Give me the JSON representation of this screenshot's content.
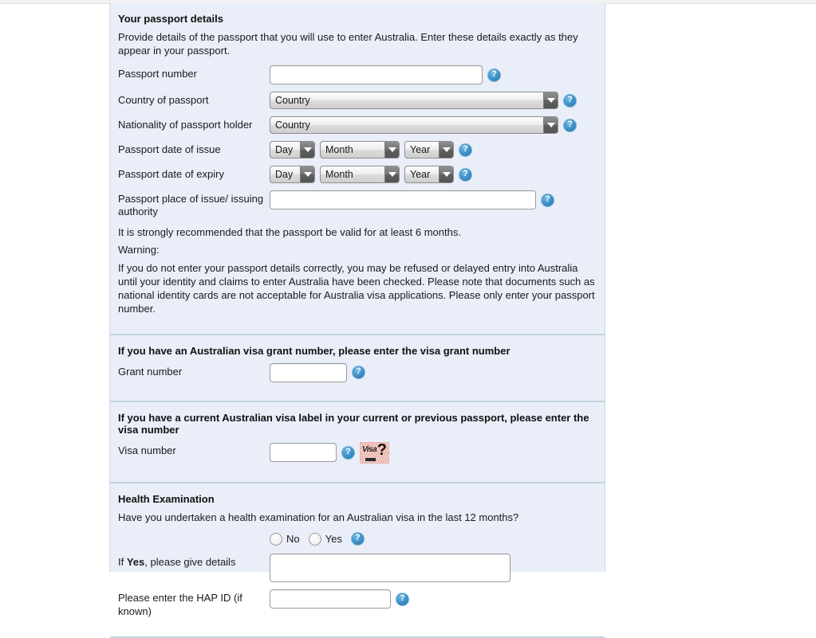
{
  "passport_section": {
    "title": "Your passport details",
    "description": "Provide details of the passport that you will use to enter Australia. Enter these details exactly as they appear in your passport.",
    "fields": {
      "passport_number_label": "Passport number",
      "passport_number_value": "",
      "country_of_passport_label": "Country of passport",
      "country_of_passport_value": "Country",
      "nationality_label": "Nationality of passport holder",
      "nationality_value": "Country",
      "date_of_issue_label": "Passport date of issue",
      "date_of_expiry_label": "Passport date of expiry",
      "day_value": "Day",
      "month_value": "Month",
      "year_value": "Year",
      "place_of_issue_label": "Passport place of issue/ issuing authority",
      "place_of_issue_value": ""
    },
    "recommendation": "It is strongly recommended that the passport be valid for at least 6 months.",
    "warning_label": "Warning:",
    "warning_text": "If you do not enter your passport details correctly, you may be refused or delayed entry into Australia until your identity and claims to enter Australia have been checked. Please note that documents such as national identity cards are not acceptable for Australia visa applications. Please only enter your passport number."
  },
  "grant_section": {
    "heading": "If you have an Australian visa grant number, please enter the visa grant number",
    "grant_number_label": "Grant number",
    "grant_number_value": ""
  },
  "visa_label_section": {
    "heading": "If you have a current Australian visa label in your current or previous passport, please enter the visa number",
    "visa_number_label": "Visa number",
    "visa_number_value": "",
    "thumbnail_word": "Visa",
    "thumbnail_mark": "?"
  },
  "health_section": {
    "title": "Health Examination",
    "question": "Have you undertaken a health examination for an Australian visa in the last 12 months?",
    "option_no": "No",
    "option_yes": "Yes",
    "details_label_prefix": "If ",
    "details_label_bold": "Yes",
    "details_label_suffix": ", please give details",
    "details_value": "",
    "hap_label": "Please enter the HAP ID (if known)",
    "hap_value": ""
  },
  "icons": {
    "help": "help-icon",
    "dropdown_arrow": "chevron-down-icon",
    "visa_sample": "visa-sample-thumbnail"
  },
  "colors": {
    "panel_background": "#e9eef8",
    "divider": "#c3d4e0",
    "help_blue": "#3b8fc7"
  }
}
